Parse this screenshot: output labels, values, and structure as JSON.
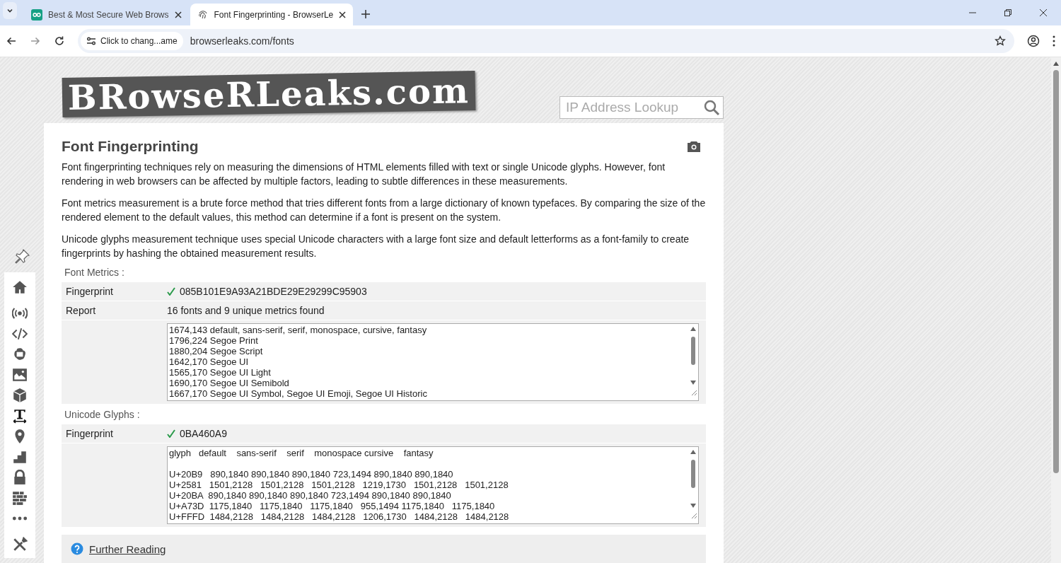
{
  "browser": {
    "tabs": [
      {
        "title": "Best & Most Secure Web Brows",
        "selected": false
      },
      {
        "title": "Font Fingerprinting - BrowserLe",
        "selected": true
      }
    ],
    "site_info": "Click to chang...ame",
    "url": "browserleaks.com/fonts"
  },
  "site": {
    "logo": "BRowseRLeaks.com",
    "search": {
      "placeholder": "IP Address Lookup"
    }
  },
  "page": {
    "title": "Font Fingerprinting",
    "paragraphs": [
      "Font fingerprinting techniques rely on measuring the dimensions of HTML elements filled with text or single Unicode glyphs. However, font rendering in web browsers can be affected by multiple factors, leading to subtle differences in these measurements.",
      "Font metrics measurement is a brute force method that tries different fonts from a large dictionary of known typefaces. By comparing the size of the rendered element to the default values, this method can determine if a font is present on the system.",
      "Unicode glyphs measurement technique uses special Unicode characters with a large font size and default letterforms as a font-family to create fingerprints by hashing the obtained measurement results."
    ],
    "sections": [
      {
        "heading": "Font Metrics :",
        "rows": [
          {
            "kind": "value",
            "label": "Fingerprint",
            "value": "085B101E9A93A21BDE29E29299C95903",
            "verified": true
          },
          {
            "kind": "value",
            "label": "Report",
            "value": "16 fonts and 9 unique metrics found",
            "verified": false
          },
          {
            "kind": "list",
            "lines": [
              "1674,143 default, sans-serif, serif, monospace, cursive, fantasy",
              "1796,224 Segoe Print",
              "1880,204 Segoe Script",
              "1642,170 Segoe UI",
              "1565,170 Segoe UI Light",
              "1690,170 Segoe UI Semibold",
              "1667,170 Segoe UI Symbol, Segoe UI Emoji, Segoe UI Historic"
            ]
          }
        ]
      },
      {
        "heading": "Unicode Glyphs :",
        "rows": [
          {
            "kind": "value",
            "label": "Fingerprint",
            "value": "0BA460A9",
            "verified": true
          },
          {
            "kind": "list",
            "header": "glyph   default    sans-serif    serif    monospace cursive    fantasy",
            "lines": [
              "U+20B9   890,1840 890,1840 890,1840 723,1494 890,1840 890,1840",
              "U+2581   1501,2128   1501,2128   1501,2128   1219,1730   1501,2128   1501,2128",
              "U+20BA  890,1840 890,1840 890,1840 723,1494 890,1840 890,1840",
              "U+A73D  1175,1840   1175,1840   1175,1840   955,1494 1175,1840   1175,1840",
              "U+FFFD  1484,2128   1484,2128   1484,2128   1206,1730   1484,2128   1484,2128"
            ]
          }
        ]
      }
    ],
    "further_reading": "Further Reading"
  }
}
